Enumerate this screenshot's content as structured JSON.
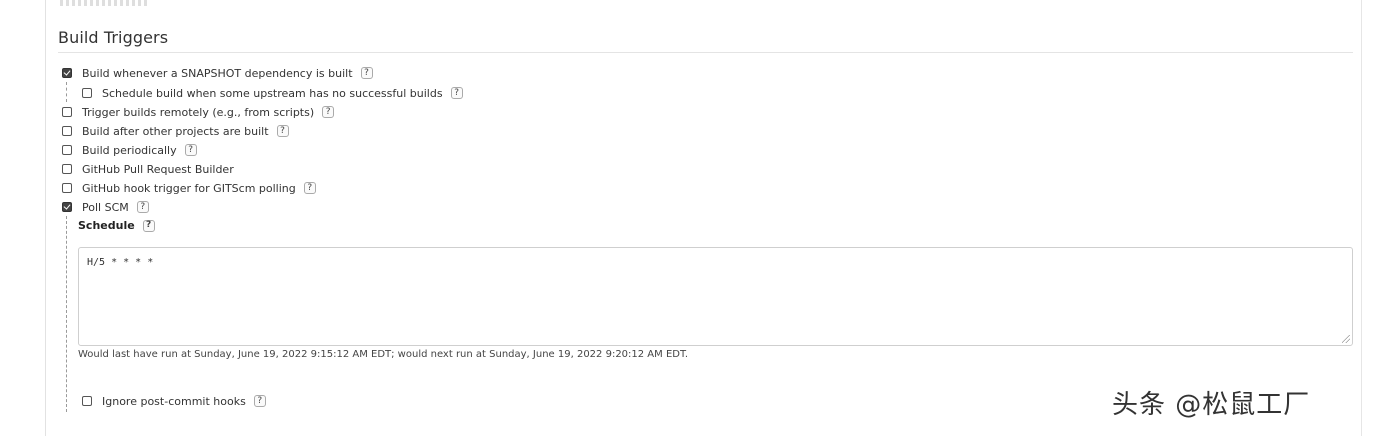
{
  "section": {
    "title": "Build Triggers"
  },
  "triggers": [
    {
      "label": "Build whenever a SNAPSHOT dependency is built",
      "checked": true,
      "help": "?"
    },
    {
      "label": "Schedule build when some upstream has no successful builds",
      "checked": false,
      "help": "?"
    },
    {
      "label": "Trigger builds remotely (e.g., from scripts)",
      "checked": false,
      "help": "?"
    },
    {
      "label": "Build after other projects are built",
      "checked": false,
      "help": "?"
    },
    {
      "label": "Build periodically",
      "checked": false,
      "help": "?"
    },
    {
      "label": "GitHub Pull Request Builder",
      "checked": false
    },
    {
      "label": "GitHub hook trigger for GITScm polling",
      "checked": false,
      "help": "?"
    },
    {
      "label": "Poll SCM",
      "checked": true,
      "help": "?"
    }
  ],
  "poll_scm": {
    "schedule_label": "Schedule",
    "schedule_help": "?",
    "schedule_value": "H/5 * * * *",
    "schedule_info": "Would last have run at Sunday, June 19, 2022 9:15:12 AM EDT; would next run at Sunday, June 19, 2022 9:20:12 AM EDT.",
    "ignore_post_commit_label": "Ignore post-commit hooks",
    "ignore_post_commit_checked": false,
    "ignore_post_commit_help": "?"
  },
  "watermark": {
    "text": "头条 @松鼠工厂"
  },
  "icons": {
    "checkbox": "checkbox-icon",
    "help": "help-icon",
    "resize": "resize-grip-icon"
  }
}
